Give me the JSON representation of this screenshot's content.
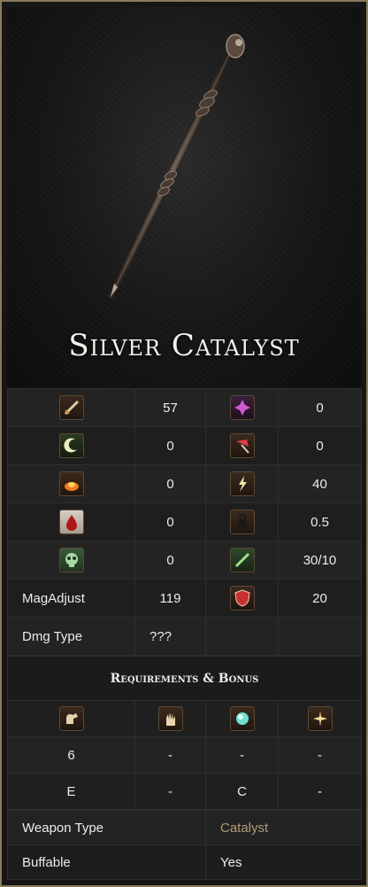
{
  "weapon": {
    "name": "Silver Catalyst",
    "image_icon": "silver-catalyst-wand-image"
  },
  "stats": [
    {
      "left_icon": "physical-attack-icon",
      "left_value": "57",
      "right_icon": "critical-hit-icon",
      "right_value": "0"
    },
    {
      "left_icon": "magic-attack-icon",
      "left_value": "0",
      "right_icon": "bow-bonus-icon",
      "right_value": "0"
    },
    {
      "left_icon": "fire-attack-icon",
      "left_value": "0",
      "right_icon": "lightning-attack-icon",
      "right_value": "40"
    },
    {
      "left_icon": "bleed-icon",
      "left_value": "0",
      "right_icon": "weight-icon",
      "right_value": "0.5"
    },
    {
      "left_icon": "poison-icon",
      "left_value": "0",
      "right_icon": "durability-icon",
      "right_value": "30/10"
    },
    {
      "left_label": "MagAdjust",
      "left_value": "119",
      "right_icon": "stability-icon",
      "right_value": "20"
    },
    {
      "left_label": "Dmg Type",
      "left_value": "???"
    }
  ],
  "requirements": {
    "heading": "Requirements & Bonus",
    "icons": [
      "strength-icon",
      "dexterity-icon",
      "intelligence-icon",
      "faith-icon"
    ],
    "required": [
      "6",
      "-",
      "-",
      "-"
    ],
    "bonus": [
      "E",
      "-",
      "C",
      "-"
    ]
  },
  "info": {
    "weapon_type_label": "Weapon Type",
    "weapon_type_value": "Catalyst",
    "buffable_label": "Buffable",
    "buffable_value": "Yes"
  },
  "colors": {
    "frame": "#8a7a5a",
    "link": "#b09a78",
    "text": "#ececec"
  }
}
